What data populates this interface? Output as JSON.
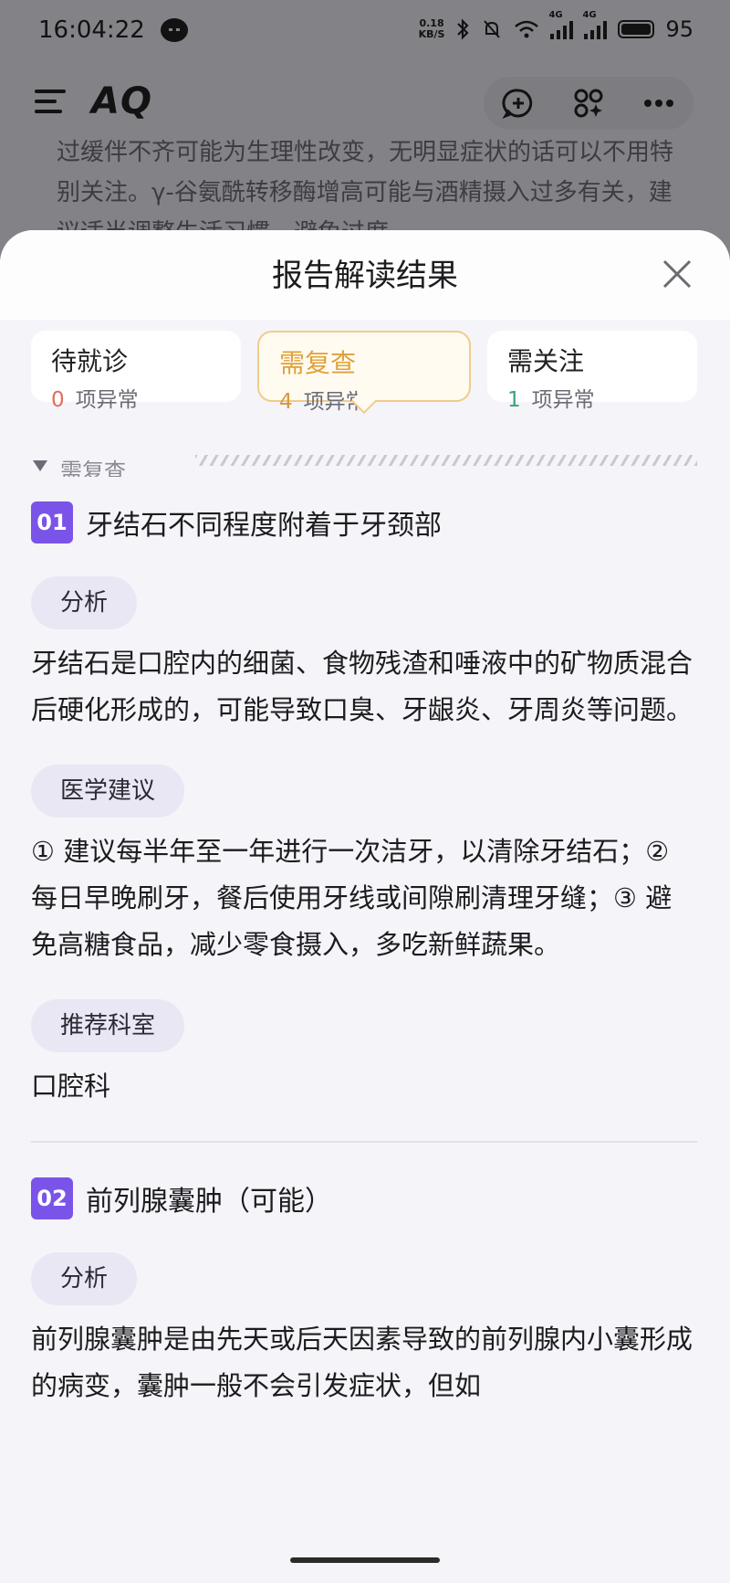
{
  "status_bar": {
    "time": "16:04:22",
    "speed_top": "0.18",
    "speed_bottom": "KB/S",
    "net_label_1": "4G",
    "net_label_2": "4G",
    "battery": "95"
  },
  "app_bar": {
    "logo": "AQ"
  },
  "background": {
    "text": "过缓伴不齐可能为生理性改变，无明显症状的话可以不用特别关注。γ-谷氨酰转移酶增高可能与酒精摄入过多有关，建议适当调整生活习惯，避免过度"
  },
  "sheet": {
    "title": "报告解读结果",
    "tabs": [
      {
        "label": "待就诊",
        "count": "0",
        "suffix": "项异常"
      },
      {
        "label": "需复查",
        "count": "4",
        "suffix": "项异常"
      },
      {
        "label": "需关注",
        "count": "1",
        "suffix": "项异常"
      }
    ],
    "section_label": "需复查",
    "items": [
      {
        "num": "01",
        "title": "牙结石不同程度附着于牙颈部",
        "analysis_label": "分析",
        "analysis": "牙结石是口腔内的细菌、食物残渣和唾液中的矿物质混合后硬化形成的，可能导致口臭、牙龈炎、牙周炎等问题。",
        "advice_label": "医学建议",
        "advice": "① 建议每半年至一年进行一次洁牙，以清除牙结石；② 每日早晚刷牙，餐后使用牙线或间隙刷清理牙缝；③ 避免高糖食品，减少零食摄入，多吃新鲜蔬果。",
        "dept_label": "推荐科室",
        "dept": "口腔科"
      },
      {
        "num": "02",
        "title": "前列腺囊肿（可能）",
        "analysis_label": "分析",
        "analysis": "前列腺囊肿是由先天或后天因素导致的前列腺内小囊形成的病变，囊肿一般不会引发症状，但如"
      }
    ]
  },
  "colors": {
    "accent_purple": "#7a54e8",
    "active_tab_amber": "#e0a13a",
    "red_count": "#e26d5a",
    "green_count": "#3aa17e"
  }
}
